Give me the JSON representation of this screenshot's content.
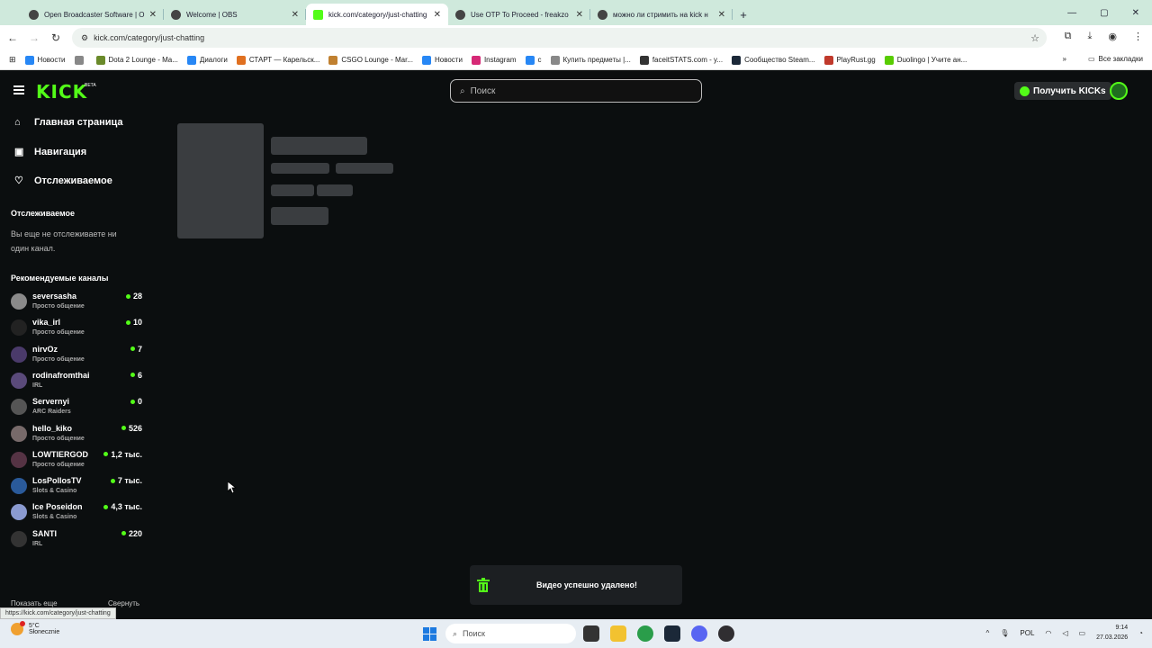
{
  "browser": {
    "tabs": [
      {
        "title": "Open Broadcaster Software | O",
        "active": false
      },
      {
        "title": "Welcome | OBS",
        "active": false
      },
      {
        "title": "kick.com/category/just-chatting",
        "active": true
      },
      {
        "title": "Use OTP To Proceed - freakzo",
        "active": false
      },
      {
        "title": "можно ли стримить на kick н",
        "active": false
      }
    ],
    "new_tab": "+",
    "url": "kick.com/category/just-chatting",
    "bookmarks": [
      {
        "label": "Новости",
        "color": "#2787f5"
      },
      {
        "label": "",
        "color": "#888888"
      },
      {
        "label": "Dota 2 Lounge - Ma...",
        "color": "#6a8a2a"
      },
      {
        "label": "Диалоги",
        "color": "#2787f5"
      },
      {
        "label": "СТАРТ — Карельск...",
        "color": "#e07020"
      },
      {
        "label": "CSGO Lounge - Mar...",
        "color": "#c08030"
      },
      {
        "label": "Новости",
        "color": "#2787f5"
      },
      {
        "label": "Instagram",
        "color": "#d62976"
      },
      {
        "label": "с",
        "color": "#2787f5"
      },
      {
        "label": "Купить предметы |...",
        "color": "#888888"
      },
      {
        "label": "faceitSTATS.com - y...",
        "color": "#333333"
      },
      {
        "label": "Сообщество Steam...",
        "color": "#1b2838"
      },
      {
        "label": "PlayRust.gg",
        "color": "#c0392b"
      },
      {
        "label": "Duolingo | Учите ан...",
        "color": "#58cc02"
      }
    ],
    "all_bookmarks": "Все закладки",
    "status_url": "https://kick.com/category/just-chatting"
  },
  "kick": {
    "logo": "KICK",
    "logo_sup": "BETA",
    "search_placeholder": "Поиск",
    "get_kicks": "Получить KICKs",
    "nav": [
      {
        "label": "Главная страница",
        "icon": "home-icon",
        "glyph": "⌂"
      },
      {
        "label": "Навигация",
        "icon": "compass-icon",
        "glyph": "▣"
      },
      {
        "label": "Отслеживаемое",
        "icon": "heart-icon",
        "glyph": "♡"
      }
    ],
    "following_title": "Отслеживаемое",
    "following_empty": "Вы еще не отслеживаете ни один канал.",
    "recommended_title": "Рекомендуемые каналы",
    "channels": [
      {
        "name": "seversasha",
        "category": "Просто общение",
        "viewers": "28"
      },
      {
        "name": "vika_irl",
        "category": "Просто общение",
        "viewers": "10"
      },
      {
        "name": "nirvOz",
        "category": "Просто общение",
        "viewers": "7"
      },
      {
        "name": "rodinafromthai",
        "category": "IRL",
        "viewers": "6"
      },
      {
        "name": "Servernyi",
        "category": "ARC Raiders",
        "viewers": "0"
      },
      {
        "name": "hello_kiko",
        "category": "Просто общение",
        "viewers": "526"
      },
      {
        "name": "LOWTIERGOD",
        "category": "Просто общение",
        "viewers": "1,2 тыс."
      },
      {
        "name": "LosPollosTV",
        "category": "Slots & Casino",
        "viewers": "7 тыс."
      },
      {
        "name": "Ice Poseidon",
        "category": "Slots & Casino",
        "viewers": "4,3 тыс."
      },
      {
        "name": "SANTI",
        "category": "IRL",
        "viewers": "220"
      }
    ],
    "show_more": "Показать еще",
    "collapse": "Свернуть",
    "toast": "Видео успешно удалено!",
    "accent": "#53fc18"
  },
  "taskbar": {
    "weather_temp": "5°C",
    "weather_desc": "Słonecznie",
    "search_placeholder": "Поиск",
    "lang": "POL",
    "time": "9:14",
    "date": "27.03.2026"
  }
}
